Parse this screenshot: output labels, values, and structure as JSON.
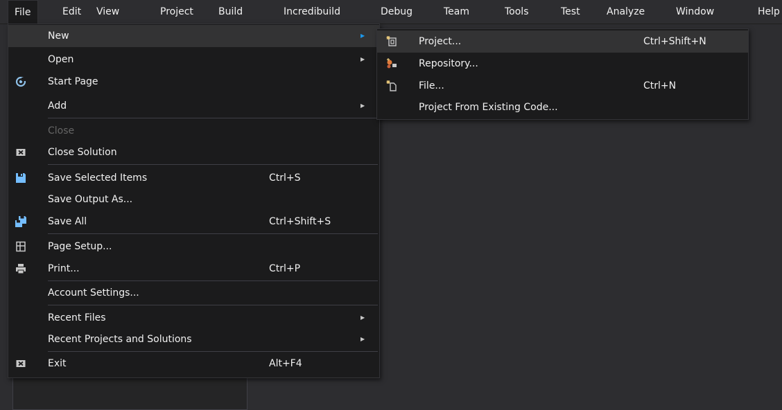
{
  "menubar": {
    "items": [
      "File",
      "Edit",
      "View",
      "Project",
      "Build",
      "Incredibuild",
      "Debug",
      "Team",
      "Tools",
      "Test",
      "Analyze",
      "Window",
      "Help"
    ]
  },
  "file_menu": {
    "items": [
      {
        "label": "New",
        "shortcut": "",
        "submenu": true,
        "icon": ""
      },
      {
        "label": "Open",
        "shortcut": "",
        "submenu": true,
        "icon": ""
      },
      {
        "label": "Start Page",
        "shortcut": "",
        "submenu": false,
        "icon": "start-page-icon"
      },
      {
        "label": "Add",
        "shortcut": "",
        "submenu": true,
        "icon": ""
      },
      {
        "label": "Close",
        "shortcut": "",
        "submenu": false,
        "icon": "",
        "disabled": true
      },
      {
        "label": "Close Solution",
        "shortcut": "",
        "submenu": false,
        "icon": "close-solution-icon"
      },
      {
        "label": "Save Selected Items",
        "shortcut": "Ctrl+S",
        "submenu": false,
        "icon": "save-icon"
      },
      {
        "label": "Save Output As...",
        "shortcut": "",
        "submenu": false,
        "icon": ""
      },
      {
        "label": "Save All",
        "shortcut": "Ctrl+Shift+S",
        "submenu": false,
        "icon": "save-all-icon"
      },
      {
        "label": "Page Setup...",
        "shortcut": "",
        "submenu": false,
        "icon": "page-setup-icon"
      },
      {
        "label": "Print...",
        "shortcut": "Ctrl+P",
        "submenu": false,
        "icon": "print-icon"
      },
      {
        "label": "Account Settings...",
        "shortcut": "",
        "submenu": false,
        "icon": ""
      },
      {
        "label": "Recent Files",
        "shortcut": "",
        "submenu": true,
        "icon": ""
      },
      {
        "label": "Recent Projects and Solutions",
        "shortcut": "",
        "submenu": true,
        "icon": ""
      },
      {
        "label": "Exit",
        "shortcut": "Alt+F4",
        "submenu": false,
        "icon": "exit-icon"
      }
    ]
  },
  "new_submenu": {
    "items": [
      {
        "label": "Project...",
        "shortcut": "Ctrl+Shift+N",
        "icon": "new-project-icon"
      },
      {
        "label": "Repository...",
        "shortcut": "",
        "icon": "repository-icon"
      },
      {
        "label": "File...",
        "shortcut": "Ctrl+N",
        "icon": "new-file-icon"
      },
      {
        "label": "Project From Existing Code...",
        "shortcut": "",
        "icon": ""
      }
    ]
  },
  "colors": {
    "menubar_bg": "#2d2d30",
    "menu_bg": "#1b1b1c",
    "highlight": "#333334",
    "accent": "#1c97ea",
    "text": "#f1f1f1",
    "disabled": "#656565"
  }
}
